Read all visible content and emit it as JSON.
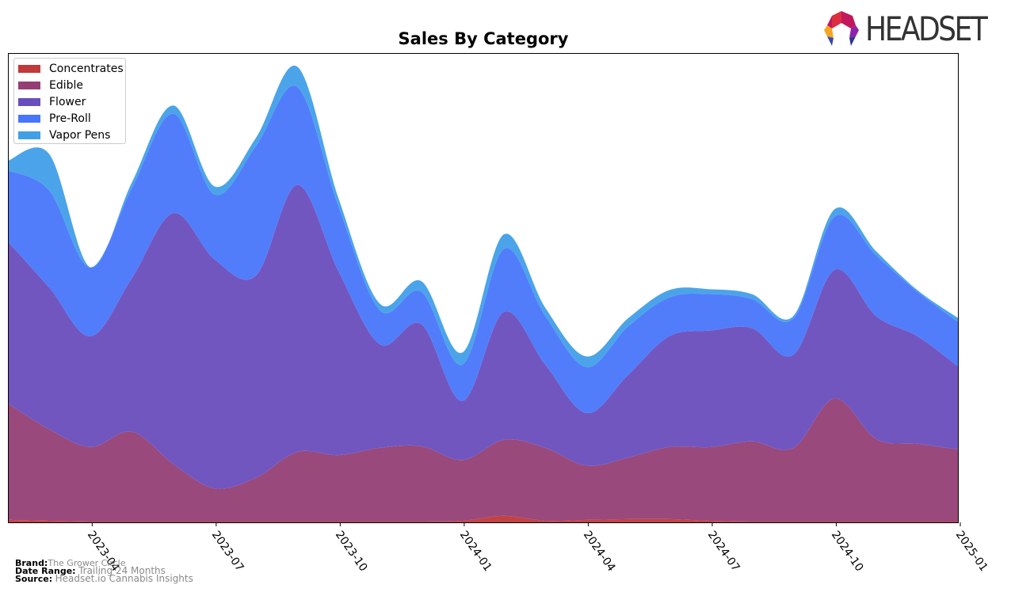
{
  "brand_logo": {
    "text": "HEADSET"
  },
  "footer": {
    "brand_label": "Brand:",
    "brand_value": "The Grower Circle",
    "date_range_label": "Date Range:",
    "date_range_value": "Trailing 24 Months",
    "source_label": "Source:",
    "source_value": "Headset.io Cannabis Insights"
  },
  "chart_data": {
    "type": "area",
    "stacked": true,
    "title": "Sales By Category",
    "xlabel": "",
    "ylabel": "",
    "y_axis_visible": false,
    "grid": false,
    "legend_position": "top-left",
    "x": [
      "2023-02",
      "2023-03",
      "2023-04",
      "2023-05",
      "2023-06",
      "2023-07",
      "2023-08",
      "2023-09",
      "2023-10",
      "2023-11",
      "2023-12",
      "2024-01",
      "2024-02",
      "2024-03",
      "2024-04",
      "2024-05",
      "2024-06",
      "2024-07",
      "2024-08",
      "2024-09",
      "2024-10",
      "2024-11",
      "2024-12",
      "2025-01"
    ],
    "x_tick_labels": [
      "2023-04",
      "2023-07",
      "2023-10",
      "2024-01",
      "2024-04",
      "2024-07",
      "2024-10",
      "2025-01"
    ],
    "x_ticks_at": [
      "2023-04",
      "2023-07",
      "2023-10",
      "2024-01",
      "2024-04",
      "2024-07",
      "2024-10",
      "2025-01"
    ],
    "series": [
      {
        "name": "Concentrates",
        "color": "#c0393b",
        "values": [
          3,
          2,
          1,
          1,
          1,
          1,
          1,
          1,
          1,
          1,
          1,
          2,
          8,
          2,
          3,
          4,
          4,
          2,
          1,
          1,
          1,
          1,
          1,
          1
        ]
      },
      {
        "name": "Edible",
        "color": "#933f74",
        "values": [
          144,
          113,
          92,
          111,
          71,
          41,
          54,
          86,
          82,
          91,
          93,
          75,
          94,
          90,
          67,
          76,
          89,
          91,
          99,
          91,
          152,
          102,
          96,
          89
        ]
      },
      {
        "name": "Flower",
        "color": "#6a4dbd",
        "values": [
          200,
          175,
          137,
          190,
          310,
          283,
          250,
          330,
          227,
          128,
          151,
          73,
          158,
          103,
          65,
          102,
          137,
          144,
          140,
          115,
          159,
          152,
          133,
          102
        ]
      },
      {
        "name": "Pre-Roll",
        "color": "#4876fb",
        "values": [
          88,
          120,
          85,
          111,
          123,
          80,
          160,
          121,
          80,
          42,
          40,
          45,
          78,
          60,
          57,
          60,
          48,
          45,
          36,
          45,
          66,
          75,
          55,
          55
        ]
      },
      {
        "name": "Vapor Pens",
        "color": "#419fe8",
        "values": [
          12,
          45,
          0,
          7,
          10,
          10,
          10,
          25,
          10,
          8,
          13,
          15,
          18,
          10,
          13,
          10,
          9,
          6,
          6,
          3,
          9,
          5,
          2,
          5
        ]
      }
    ]
  }
}
